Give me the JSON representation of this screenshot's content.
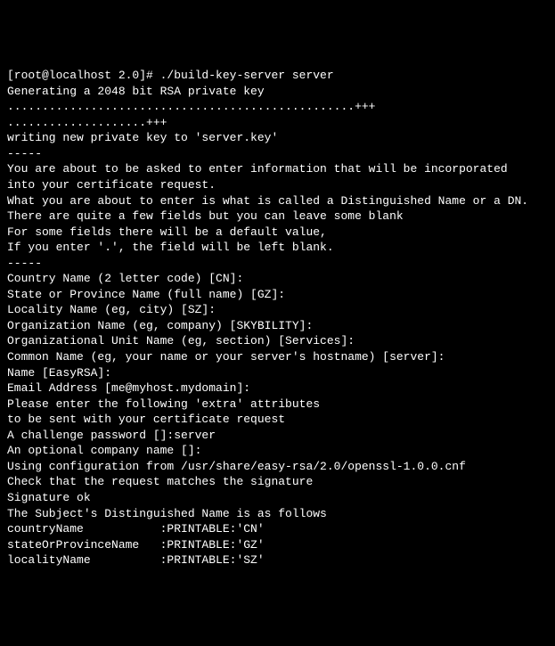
{
  "terminal": {
    "lines": [
      "[root@localhost 2.0]# ./build-key-server server",
      "Generating a 2048 bit RSA private key",
      "..................................................+++",
      "....................+++",
      "writing new private key to 'server.key'",
      "-----",
      "You are about to be asked to enter information that will be incorporated",
      "into your certificate request.",
      "What you are about to enter is what is called a Distinguished Name or a DN.",
      "There are quite a few fields but you can leave some blank",
      "For some fields there will be a default value,",
      "If you enter '.', the field will be left blank.",
      "-----",
      "Country Name (2 letter code) [CN]:",
      "State or Province Name (full name) [GZ]:",
      "Locality Name (eg, city) [SZ]:",
      "Organization Name (eg, company) [SKYBILITY]:",
      "Organizational Unit Name (eg, section) [Services]:",
      "Common Name (eg, your name or your server's hostname) [server]:",
      "Name [EasyRSA]:",
      "Email Address [me@myhost.mydomain]:",
      "",
      "Please enter the following 'extra' attributes",
      "to be sent with your certificate request",
      "A challenge password []:server",
      "An optional company name []:",
      "Using configuration from /usr/share/easy-rsa/2.0/openssl-1.0.0.cnf",
      "Check that the request matches the signature",
      "Signature ok",
      "The Subject's Distinguished Name is as follows",
      "countryName           :PRINTABLE:'CN'",
      "stateOrProvinceName   :PRINTABLE:'GZ'",
      "localityName          :PRINTABLE:'SZ'"
    ]
  }
}
